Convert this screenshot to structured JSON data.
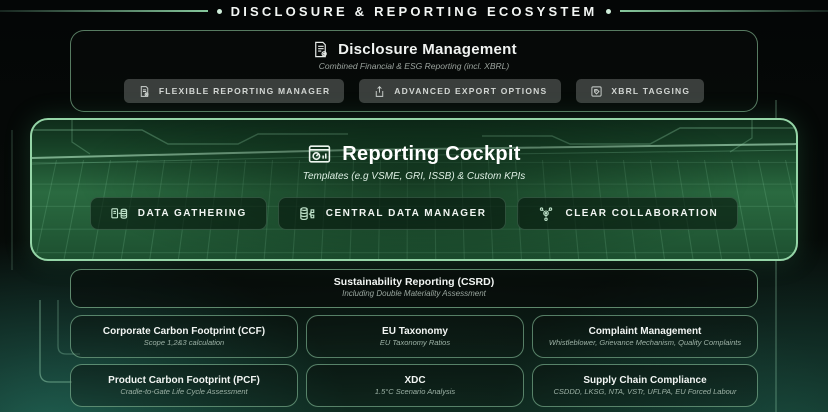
{
  "page": {
    "title": "DISCLOSURE & REPORTING ECOSYSTEM"
  },
  "disclosure_management": {
    "title": "Disclosure Management",
    "subtitle": "Combined Financial & ESG Reporting (incl. XBRL)",
    "icon": "document-gear-icon",
    "buttons": [
      {
        "label": "FLEXIBLE REPORTING MANAGER",
        "icon": "report-gear-icon"
      },
      {
        "label": "ADVANCED EXPORT OPTIONS",
        "icon": "export-icon"
      },
      {
        "label": "XBRL TAGGING",
        "icon": "tag-icon"
      }
    ]
  },
  "reporting_cockpit": {
    "title": "Reporting Cockpit",
    "subtitle": "Templates (e.g VSME, GRI, ISSB) & Custom KPIs",
    "icon": "dashboard-icon",
    "buttons": [
      {
        "label": "DATA GATHERING",
        "icon": "document-database-icon"
      },
      {
        "label": "CENTRAL DATA MANAGER",
        "icon": "database-network-icon"
      },
      {
        "label": "CLEAR COLLABORATION",
        "icon": "collaboration-gear-icon"
      }
    ]
  },
  "sustainability_reporting": {
    "title": "Sustainability Reporting (CSRD)",
    "subtitle": "Including Double Materiality Assessment"
  },
  "modules": [
    {
      "title": "Corporate Carbon Footprint (CCF)",
      "subtitle": "Scope 1,2&3 calculation"
    },
    {
      "title": "EU Taxonomy",
      "subtitle": "EU Taxonomy Ratios"
    },
    {
      "title": "Complaint Management",
      "subtitle": "Whistleblower, Grievance Mechanism, Quality Complaints"
    },
    {
      "title": "Product Carbon Footprint (PCF)",
      "subtitle": "Cradle-to-Gate Life Cycle Assessment"
    },
    {
      "title": "XDC",
      "subtitle": "1.5°C Scenario Analysis"
    },
    {
      "title": "Supply Chain Compliance",
      "subtitle": "CSDDD, LKSG, NTA, VSTr, UFLPA, EU Forced Labour"
    }
  ],
  "colors": {
    "accent_green": "#95d5a7",
    "button_gray": "#3a3e3c",
    "cockpit_green": "#2a6a40",
    "glow_teal": "#2c8a76"
  }
}
